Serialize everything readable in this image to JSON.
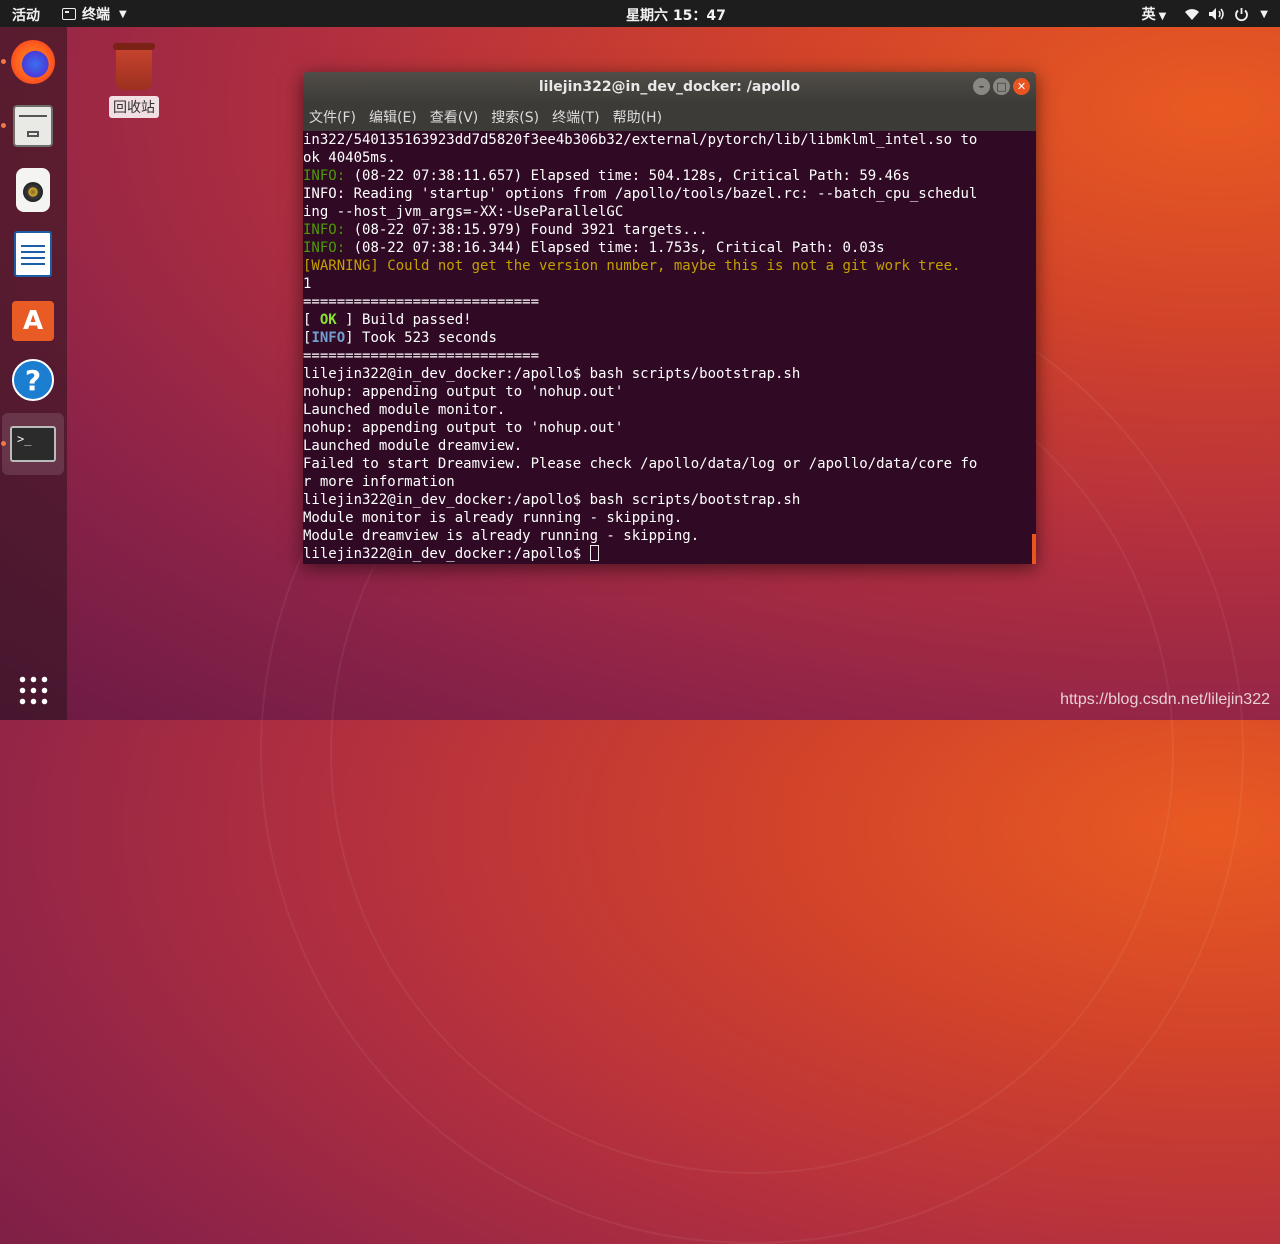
{
  "topbar": {
    "activities": "活动",
    "app_name": "终端",
    "clock": "星期六 15：47",
    "input_method": "英"
  },
  "dock": {
    "items": [
      "firefox-icon",
      "files-icon",
      "rhythmbox-icon",
      "libreoffice-writer-icon",
      "software-center-icon",
      "help-icon",
      "terminal-icon"
    ]
  },
  "desktop": {
    "trash_label": "回收站"
  },
  "window": {
    "title": "lilejin322@in_dev_docker: /apollo",
    "menu": [
      "文件(F)",
      "编辑(E)",
      "查看(V)",
      "搜索(S)",
      "终端(T)",
      "帮助(H)"
    ]
  },
  "terminal": {
    "lines": [
      "in322/540135163923dd7d5820f3ee4b306b32/external/pytorch/lib/libmklml_intel.so to",
      "ok 40405ms.",
      "(08-22 07:38:11.657) Elapsed time: 504.128s, Critical Path: 59.46s",
      "INFO: Reading 'startup' options from /apollo/tools/bazel.rc: --batch_cpu_schedul",
      "ing --host_jvm_args=-XX:-UseParallelGC",
      "(08-22 07:38:15.979) Found 3921 targets...",
      "(08-22 07:38:16.344) Elapsed time: 1.753s, Critical Path: 0.03s",
      "[WARNING] Could not get the version number, maybe this is not a git work tree.",
      "1",
      "============================",
      "Build passed!",
      "Took 523 seconds",
      "============================",
      "lilejin322@in_dev_docker:/apollo$ bash scripts/bootstrap.sh",
      "nohup: appending output to 'nohup.out'",
      "Launched module monitor.",
      "nohup: appending output to 'nohup.out'",
      "Launched module dreamview.",
      "Failed to start Dreamview. Please check /apollo/data/log or /apollo/data/core fo",
      "r more information",
      "lilejin322@in_dev_docker:/apollo$ bash scripts/bootstrap.sh",
      "Module monitor is already running - skipping.",
      "Module dreamview is already running - skipping.",
      "lilejin322@in_dev_docker:/apollo$ "
    ],
    "info_prefix": "INFO:",
    "ok_label": "OK",
    "info_label": "INFO"
  },
  "watermark": "https://blog.csdn.net/lilejin322"
}
